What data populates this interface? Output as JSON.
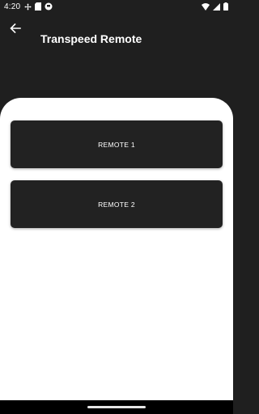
{
  "status_bar": {
    "time": "4:20",
    "icons_left": [
      "fan-icon",
      "sd-card-icon",
      "circle-app-icon"
    ],
    "icons_right": [
      "wifi-icon",
      "signal-icon",
      "battery-icon"
    ]
  },
  "app_bar": {
    "title": "Transpeed Remote",
    "back_icon": "arrow-back-icon"
  },
  "remotes": [
    {
      "label": "REMOTE 1"
    },
    {
      "label": "REMOTE 2"
    }
  ],
  "colors": {
    "background": "#1f1f1f",
    "card": "#222222",
    "sheet": "#ffffff",
    "text": "#ffffff"
  }
}
